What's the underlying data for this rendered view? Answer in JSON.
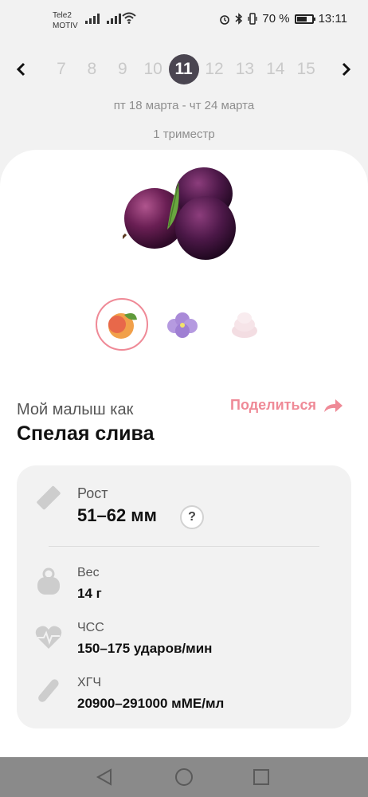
{
  "status_bar": {
    "carrier_line1": "Tele2",
    "carrier_line2": "MOTIV",
    "battery_text": "70 %",
    "battery_level": 0.7,
    "time": "13:11"
  },
  "week_nav": {
    "weeks": [
      "7",
      "8",
      "9",
      "10",
      "11",
      "12",
      "13",
      "14",
      "15"
    ],
    "active_week": "11",
    "date_range": "пт 18 марта - чт 24 марта",
    "trimester": "1 триместр"
  },
  "baby": {
    "subtitle": "Мой малыш как",
    "title": "Спелая слива",
    "share_label": "Поделиться",
    "comparisons": [
      "peach",
      "violet-flower",
      "marshmallow"
    ]
  },
  "stats": {
    "height_label": "Рост",
    "height_value": "51–62 мм",
    "help_label": "?",
    "weight_label": "Вес",
    "weight_value": "14 г",
    "hr_label": "ЧСС",
    "hr_value": "150–175 ударов/мин",
    "hcg_label": "ХГЧ",
    "hcg_value": "20900–291000 мМЕ/мл"
  },
  "colors": {
    "accent": "#ef8a97",
    "active_week_bg": "#4a4550",
    "plum": "#5a1a4a"
  }
}
